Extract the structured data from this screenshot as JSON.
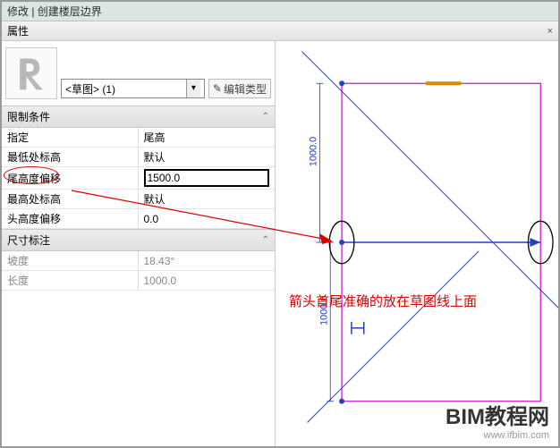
{
  "title": "修改 | 创建楼层边界",
  "panel": {
    "title": "属性",
    "close": "×"
  },
  "type": {
    "selected": "<草图> (1)",
    "editType": "编辑类型",
    "editIcon": "✎"
  },
  "cats": {
    "constraints": "限制条件",
    "dims": "尺寸标注"
  },
  "rows": {
    "assign": {
      "l": "指定",
      "r": "尾高"
    },
    "lowest": {
      "l": "最低处标高",
      "r": "默认"
    },
    "tailOffset": {
      "l": "尾高度偏移",
      "r": "1500.0"
    },
    "highest": {
      "l": "最高处标高",
      "r": "默认"
    },
    "headOffset": {
      "l": "头高度偏移",
      "r": "0.0"
    },
    "slope": {
      "l": "坡度",
      "r": "18.43°"
    },
    "length": {
      "l": "长度",
      "r": "1000.0"
    }
  },
  "canvas": {
    "dim1": "1000.0",
    "dim2": "1000.0"
  },
  "annotation": "箭头首尾准确的放在草图线上面",
  "watermark": {
    "big": "BIM教程网",
    "url": "www.ifbim.com"
  }
}
